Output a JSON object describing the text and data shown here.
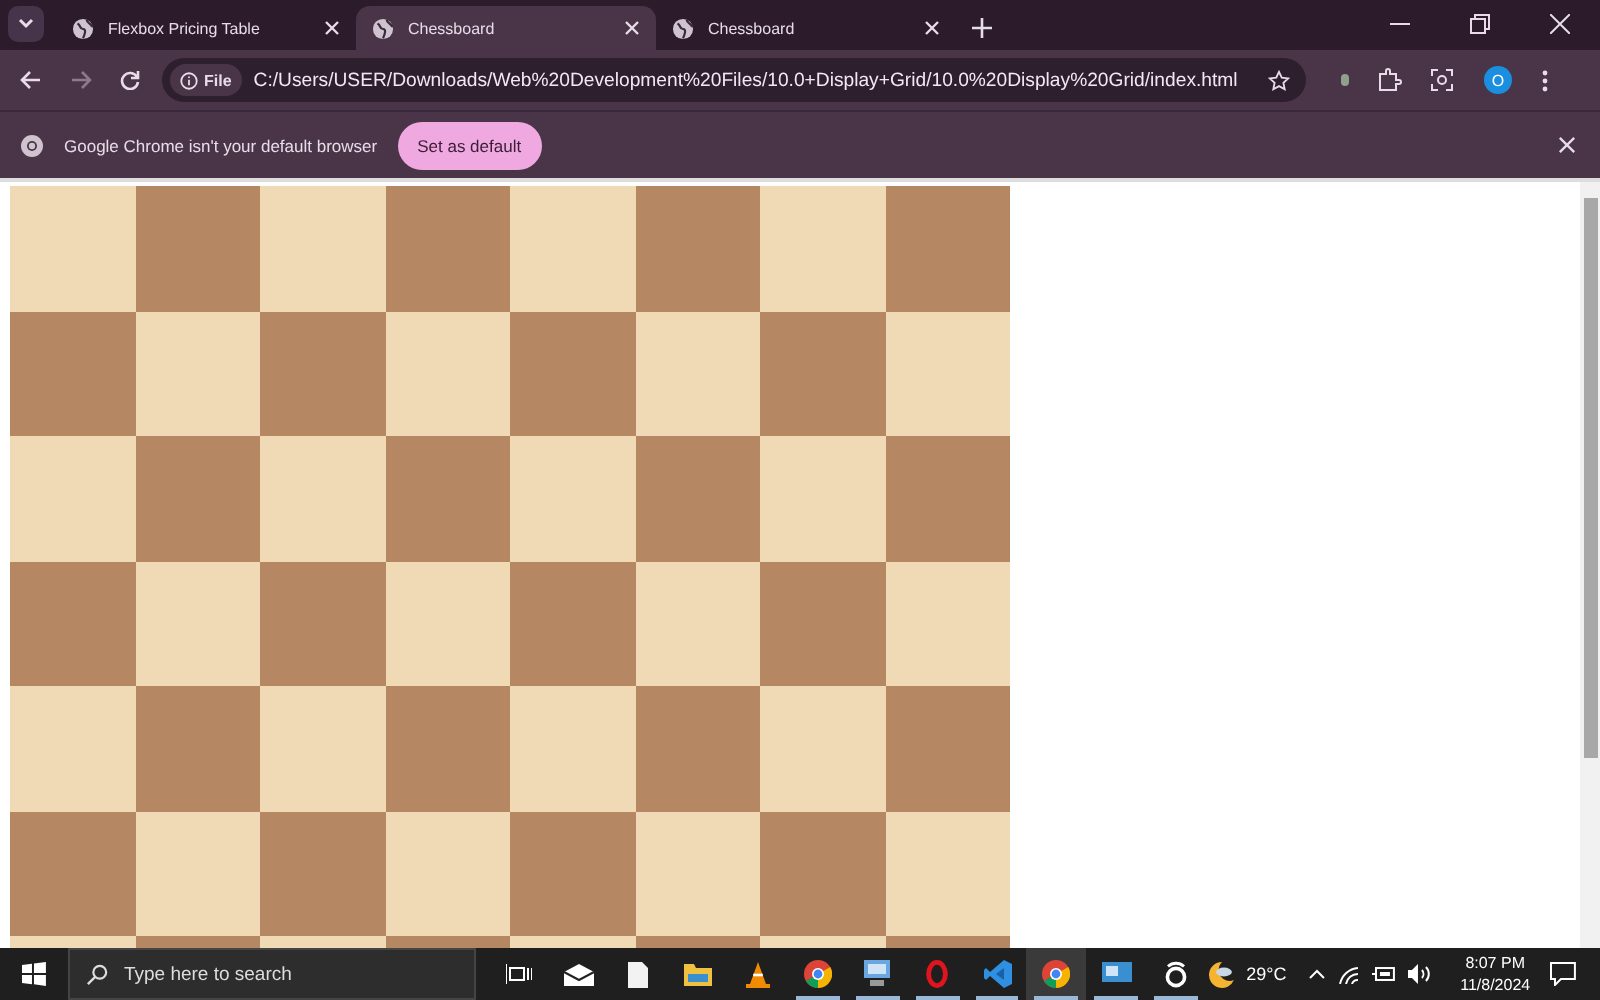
{
  "tabs": [
    {
      "title": "Flexbox Pricing Table",
      "selected": false
    },
    {
      "title": "Chessboard",
      "selected": true
    },
    {
      "title": "Chessboard",
      "selected": false
    }
  ],
  "address_bar": {
    "scheme_chip": "File",
    "url": "C:/Users/USER/Downloads/Web%20Development%20Files/10.0+Display+Grid/10.0%20Display%20Grid/index.html"
  },
  "profile": {
    "initial": "O"
  },
  "infobar": {
    "message": "Google Chrome isn't your default browser",
    "button": "Set as default"
  },
  "taskbar": {
    "search_placeholder": "Type here to search",
    "apps": [
      {
        "open": false,
        "selected": false
      },
      {
        "open": false,
        "selected": false
      },
      {
        "open": false,
        "selected": false
      },
      {
        "open": false,
        "selected": false
      },
      {
        "open": false,
        "selected": false
      },
      {
        "open": true,
        "selected": false
      },
      {
        "open": true,
        "selected": false
      },
      {
        "open": true,
        "selected": false
      },
      {
        "open": true,
        "selected": false
      },
      {
        "open": true,
        "selected": true
      },
      {
        "open": true,
        "selected": false
      },
      {
        "open": true,
        "selected": false
      }
    ],
    "temperature": "29°C",
    "time": "8:07 PM",
    "date": "11/8/2024"
  }
}
